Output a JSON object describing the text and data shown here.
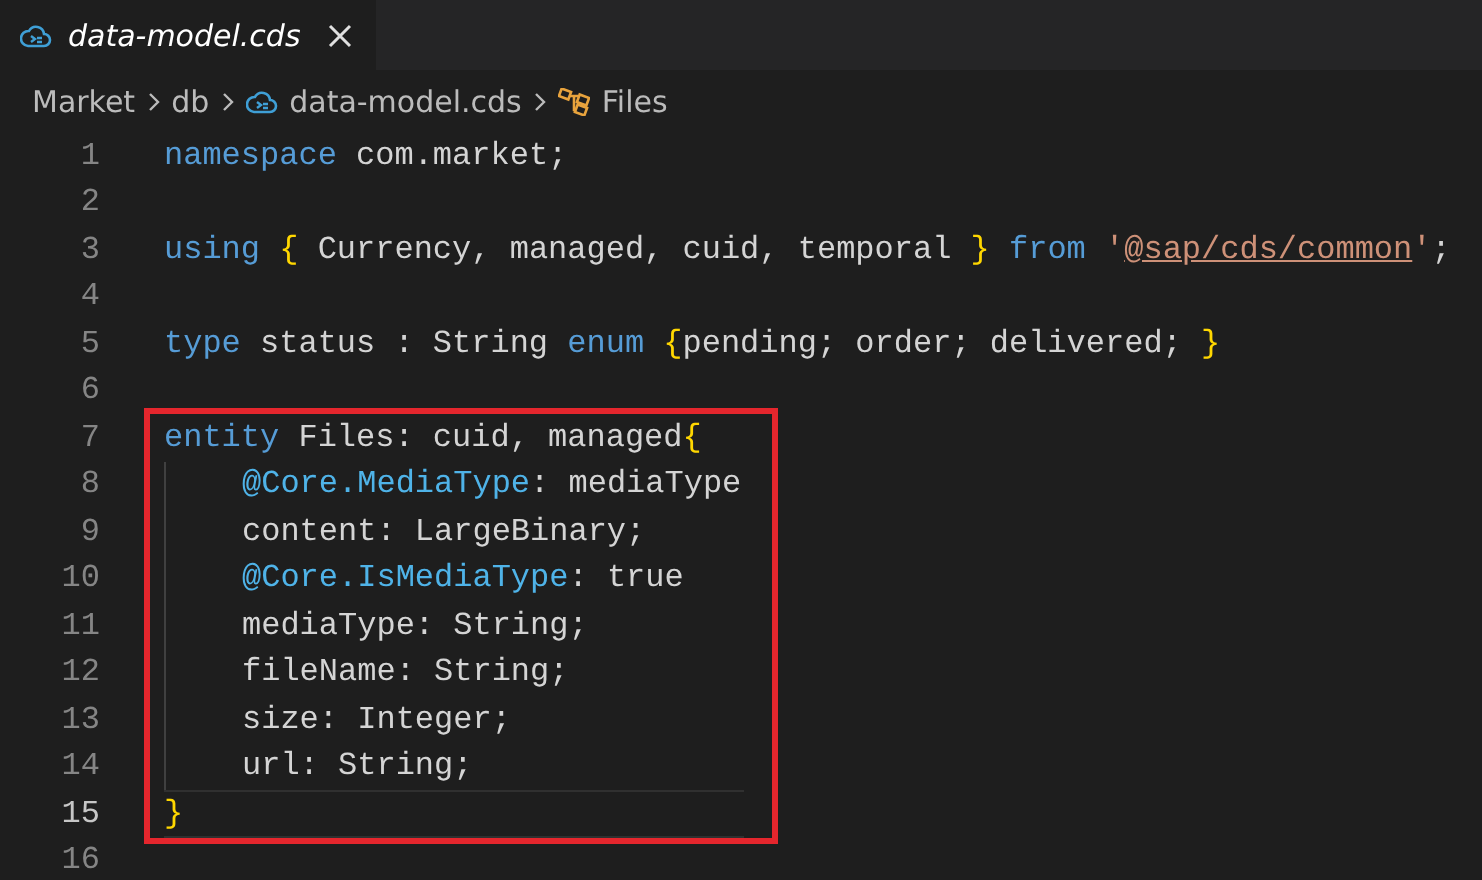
{
  "tabs": [
    {
      "label": "data-model.cds",
      "selected": true,
      "preview": true
    }
  ],
  "breadcrumb": [
    {
      "label": "Market",
      "kind": "folder"
    },
    {
      "label": "db",
      "kind": "folder"
    },
    {
      "label": "data-model.cds",
      "kind": "file"
    },
    {
      "label": "Files",
      "kind": "symbol"
    }
  ],
  "code_blocks": [
    {
      "highlighted": false,
      "lines": [
        {
          "number": "1",
          "current": false,
          "indented": false,
          "tokens": [
            {
              "t": "namespace",
              "kind": "keyword"
            },
            {
              "t": " com.market;",
              "kind": "plain"
            }
          ]
        },
        {
          "number": "2",
          "current": false
        },
        {
          "number": "3",
          "current": false,
          "indented": false,
          "tokens": [
            {
              "t": "using",
              "kind": "keyword"
            },
            {
              "t": " {",
              "kind": "brace"
            },
            {
              "t": " Currency, managed, cuid, temporal ",
              "kind": "plain"
            },
            {
              "t": "}",
              "kind": "brace"
            },
            {
              "t": " from",
              "kind": "keyword"
            },
            {
              "t": " '",
              "kind": "string"
            },
            {
              "t": "@sap/cds/common",
              "kind": "link"
            },
            {
              "t": "'",
              "kind": "string"
            },
            {
              "t": ";",
              "kind": "plain"
            }
          ]
        },
        {
          "number": "4",
          "current": false
        },
        {
          "number": "5",
          "current": false,
          "indented": false,
          "tokens": [
            {
              "t": "type",
              "kind": "keyword"
            },
            {
              "t": " status : String ",
              "kind": "plain"
            },
            {
              "t": "enum",
              "kind": "keyword"
            },
            {
              "t": " {",
              "kind": "brace"
            },
            {
              "t": "pending; order; delivered; ",
              "kind": "plain"
            },
            {
              "t": "}",
              "kind": "brace"
            }
          ]
        },
        {
          "number": "6",
          "current": false
        }
      ]
    },
    {
      "highlighted": true,
      "lines": [
        {
          "number": "7",
          "current": false,
          "indented": false,
          "tokens": [
            {
              "t": "entity",
              "kind": "keyword"
            },
            {
              "t": " Files: cuid, managed",
              "kind": "plain"
            },
            {
              "t": "{",
              "kind": "brace"
            }
          ]
        },
        {
          "number": "8",
          "current": false,
          "indented": true,
          "tokens": [
            {
              "t": "@Core.MediaType",
              "kind": "annotation"
            },
            {
              "t": ": mediaType",
              "kind": "plain"
            }
          ]
        },
        {
          "number": "9",
          "current": false,
          "indented": true,
          "tokens": [
            {
              "t": "content: LargeBinary;",
              "kind": "plain"
            }
          ]
        },
        {
          "number": "10",
          "current": false,
          "indented": true,
          "tokens": [
            {
              "t": "@Core.IsMediaType",
              "kind": "annotation"
            },
            {
              "t": ": true",
              "kind": "plain"
            }
          ]
        },
        {
          "number": "11",
          "current": false,
          "indented": true,
          "tokens": [
            {
              "t": "mediaType: String;",
              "kind": "plain"
            }
          ]
        },
        {
          "number": "12",
          "current": false,
          "indented": true,
          "tokens": [
            {
              "t": "fileName: String;",
              "kind": "plain"
            }
          ]
        },
        {
          "number": "13",
          "current": false,
          "indented": true,
          "tokens": [
            {
              "t": "size: Integer;",
              "kind": "plain"
            }
          ]
        },
        {
          "number": "14",
          "current": false,
          "indented": true,
          "tokens": [
            {
              "t": "url: String;",
              "kind": "plain"
            }
          ]
        },
        {
          "number": "15",
          "current": true,
          "indented": false,
          "tokens": [
            {
              "t": "}",
              "kind": "brace"
            }
          ]
        }
      ]
    },
    {
      "highlighted": false,
      "lines": [
        {
          "number": "16",
          "current": false
        }
      ]
    }
  ]
}
